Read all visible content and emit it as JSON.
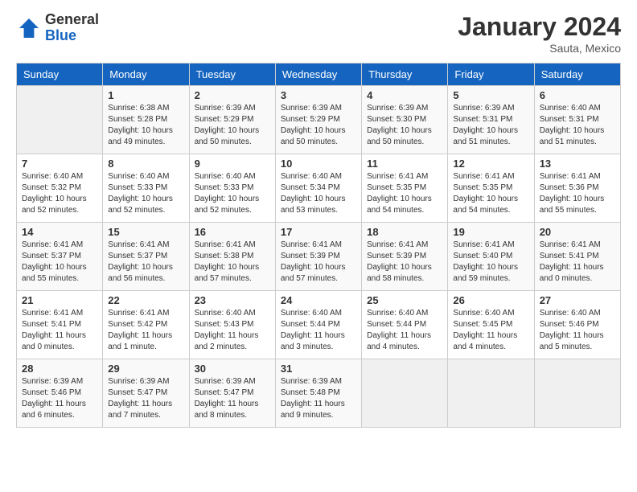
{
  "header": {
    "logo_general": "General",
    "logo_blue": "Blue",
    "title": "January 2024",
    "location": "Sauta, Mexico"
  },
  "days_of_week": [
    "Sunday",
    "Monday",
    "Tuesday",
    "Wednesday",
    "Thursday",
    "Friday",
    "Saturday"
  ],
  "weeks": [
    [
      {
        "day": "",
        "sunrise": "",
        "sunset": "",
        "daylight": ""
      },
      {
        "day": "1",
        "sunrise": "Sunrise: 6:38 AM",
        "sunset": "Sunset: 5:28 PM",
        "daylight": "Daylight: 10 hours and 49 minutes."
      },
      {
        "day": "2",
        "sunrise": "Sunrise: 6:39 AM",
        "sunset": "Sunset: 5:29 PM",
        "daylight": "Daylight: 10 hours and 50 minutes."
      },
      {
        "day": "3",
        "sunrise": "Sunrise: 6:39 AM",
        "sunset": "Sunset: 5:29 PM",
        "daylight": "Daylight: 10 hours and 50 minutes."
      },
      {
        "day": "4",
        "sunrise": "Sunrise: 6:39 AM",
        "sunset": "Sunset: 5:30 PM",
        "daylight": "Daylight: 10 hours and 50 minutes."
      },
      {
        "day": "5",
        "sunrise": "Sunrise: 6:39 AM",
        "sunset": "Sunset: 5:31 PM",
        "daylight": "Daylight: 10 hours and 51 minutes."
      },
      {
        "day": "6",
        "sunrise": "Sunrise: 6:40 AM",
        "sunset": "Sunset: 5:31 PM",
        "daylight": "Daylight: 10 hours and 51 minutes."
      }
    ],
    [
      {
        "day": "7",
        "sunrise": "Sunrise: 6:40 AM",
        "sunset": "Sunset: 5:32 PM",
        "daylight": "Daylight: 10 hours and 52 minutes."
      },
      {
        "day": "8",
        "sunrise": "Sunrise: 6:40 AM",
        "sunset": "Sunset: 5:33 PM",
        "daylight": "Daylight: 10 hours and 52 minutes."
      },
      {
        "day": "9",
        "sunrise": "Sunrise: 6:40 AM",
        "sunset": "Sunset: 5:33 PM",
        "daylight": "Daylight: 10 hours and 52 minutes."
      },
      {
        "day": "10",
        "sunrise": "Sunrise: 6:40 AM",
        "sunset": "Sunset: 5:34 PM",
        "daylight": "Daylight: 10 hours and 53 minutes."
      },
      {
        "day": "11",
        "sunrise": "Sunrise: 6:41 AM",
        "sunset": "Sunset: 5:35 PM",
        "daylight": "Daylight: 10 hours and 54 minutes."
      },
      {
        "day": "12",
        "sunrise": "Sunrise: 6:41 AM",
        "sunset": "Sunset: 5:35 PM",
        "daylight": "Daylight: 10 hours and 54 minutes."
      },
      {
        "day": "13",
        "sunrise": "Sunrise: 6:41 AM",
        "sunset": "Sunset: 5:36 PM",
        "daylight": "Daylight: 10 hours and 55 minutes."
      }
    ],
    [
      {
        "day": "14",
        "sunrise": "Sunrise: 6:41 AM",
        "sunset": "Sunset: 5:37 PM",
        "daylight": "Daylight: 10 hours and 55 minutes."
      },
      {
        "day": "15",
        "sunrise": "Sunrise: 6:41 AM",
        "sunset": "Sunset: 5:37 PM",
        "daylight": "Daylight: 10 hours and 56 minutes."
      },
      {
        "day": "16",
        "sunrise": "Sunrise: 6:41 AM",
        "sunset": "Sunset: 5:38 PM",
        "daylight": "Daylight: 10 hours and 57 minutes."
      },
      {
        "day": "17",
        "sunrise": "Sunrise: 6:41 AM",
        "sunset": "Sunset: 5:39 PM",
        "daylight": "Daylight: 10 hours and 57 minutes."
      },
      {
        "day": "18",
        "sunrise": "Sunrise: 6:41 AM",
        "sunset": "Sunset: 5:39 PM",
        "daylight": "Daylight: 10 hours and 58 minutes."
      },
      {
        "day": "19",
        "sunrise": "Sunrise: 6:41 AM",
        "sunset": "Sunset: 5:40 PM",
        "daylight": "Daylight: 10 hours and 59 minutes."
      },
      {
        "day": "20",
        "sunrise": "Sunrise: 6:41 AM",
        "sunset": "Sunset: 5:41 PM",
        "daylight": "Daylight: 11 hours and 0 minutes."
      }
    ],
    [
      {
        "day": "21",
        "sunrise": "Sunrise: 6:41 AM",
        "sunset": "Sunset: 5:41 PM",
        "daylight": "Daylight: 11 hours and 0 minutes."
      },
      {
        "day": "22",
        "sunrise": "Sunrise: 6:41 AM",
        "sunset": "Sunset: 5:42 PM",
        "daylight": "Daylight: 11 hours and 1 minute."
      },
      {
        "day": "23",
        "sunrise": "Sunrise: 6:40 AM",
        "sunset": "Sunset: 5:43 PM",
        "daylight": "Daylight: 11 hours and 2 minutes."
      },
      {
        "day": "24",
        "sunrise": "Sunrise: 6:40 AM",
        "sunset": "Sunset: 5:44 PM",
        "daylight": "Daylight: 11 hours and 3 minutes."
      },
      {
        "day": "25",
        "sunrise": "Sunrise: 6:40 AM",
        "sunset": "Sunset: 5:44 PM",
        "daylight": "Daylight: 11 hours and 4 minutes."
      },
      {
        "day": "26",
        "sunrise": "Sunrise: 6:40 AM",
        "sunset": "Sunset: 5:45 PM",
        "daylight": "Daylight: 11 hours and 4 minutes."
      },
      {
        "day": "27",
        "sunrise": "Sunrise: 6:40 AM",
        "sunset": "Sunset: 5:46 PM",
        "daylight": "Daylight: 11 hours and 5 minutes."
      }
    ],
    [
      {
        "day": "28",
        "sunrise": "Sunrise: 6:39 AM",
        "sunset": "Sunset: 5:46 PM",
        "daylight": "Daylight: 11 hours and 6 minutes."
      },
      {
        "day": "29",
        "sunrise": "Sunrise: 6:39 AM",
        "sunset": "Sunset: 5:47 PM",
        "daylight": "Daylight: 11 hours and 7 minutes."
      },
      {
        "day": "30",
        "sunrise": "Sunrise: 6:39 AM",
        "sunset": "Sunset: 5:47 PM",
        "daylight": "Daylight: 11 hours and 8 minutes."
      },
      {
        "day": "31",
        "sunrise": "Sunrise: 6:39 AM",
        "sunset": "Sunset: 5:48 PM",
        "daylight": "Daylight: 11 hours and 9 minutes."
      },
      {
        "day": "",
        "sunrise": "",
        "sunset": "",
        "daylight": ""
      },
      {
        "day": "",
        "sunrise": "",
        "sunset": "",
        "daylight": ""
      },
      {
        "day": "",
        "sunrise": "",
        "sunset": "",
        "daylight": ""
      }
    ]
  ]
}
